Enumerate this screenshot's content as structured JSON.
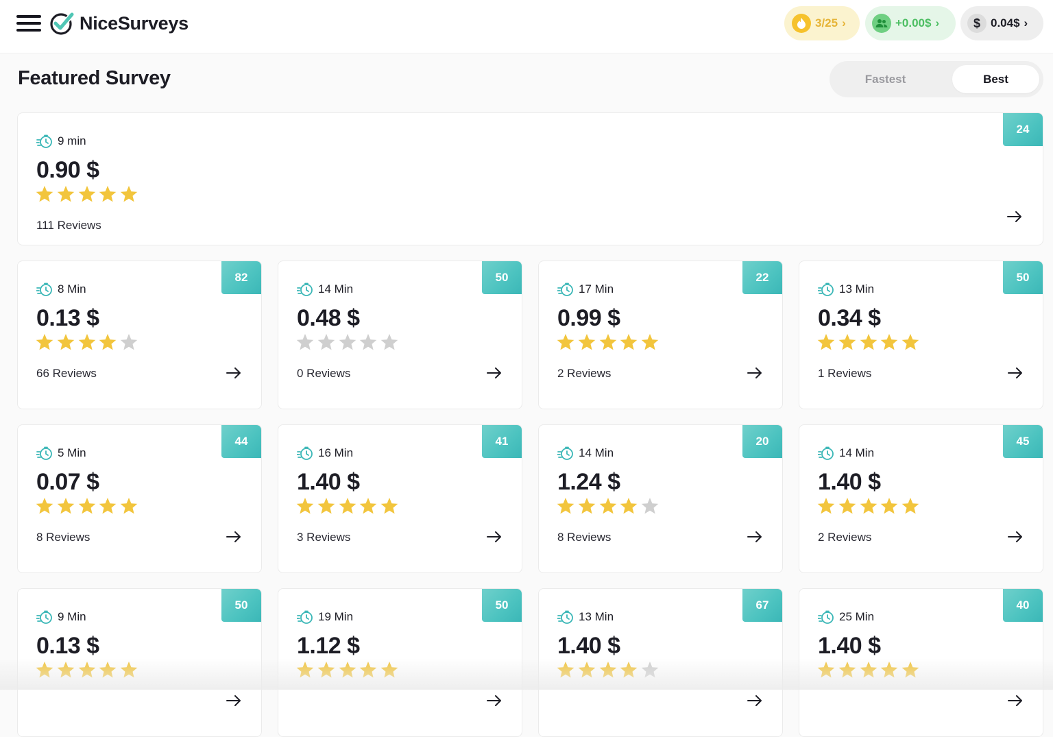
{
  "header": {
    "brand": "NiceSurveys",
    "streak": "3/25",
    "referral": "+0.00$",
    "balance": "0.04$",
    "balance_symbol": "$"
  },
  "section": {
    "title": "Featured Survey",
    "sort_options": [
      "Fastest",
      "Best"
    ],
    "sort_selected": "Best"
  },
  "colors": {
    "star_filled": "#f2c53d",
    "star_empty": "#cfcfcf",
    "badge": "#4cc3c0",
    "accent": "#3bb7b7"
  },
  "featured": {
    "badge": "24",
    "time": "9 min",
    "price": "0.90 $",
    "rating": 5,
    "reviews": "111 Reviews"
  },
  "surveys": [
    {
      "badge": "82",
      "time": "8 Min",
      "price": "0.13 $",
      "rating": 4,
      "reviews": "66 Reviews"
    },
    {
      "badge": "50",
      "time": "14 Min",
      "price": "0.48 $",
      "rating": 0,
      "reviews": "0 Reviews"
    },
    {
      "badge": "22",
      "time": "17 Min",
      "price": "0.99 $",
      "rating": 5,
      "reviews": "2 Reviews"
    },
    {
      "badge": "50",
      "time": "13 Min",
      "price": "0.34 $",
      "rating": 5,
      "reviews": "1 Reviews"
    },
    {
      "badge": "44",
      "time": "5 Min",
      "price": "0.07 $",
      "rating": 5,
      "reviews": "8 Reviews"
    },
    {
      "badge": "41",
      "time": "16 Min",
      "price": "1.40 $",
      "rating": 5,
      "reviews": "3 Reviews"
    },
    {
      "badge": "20",
      "time": "14 Min",
      "price": "1.24 $",
      "rating": 4,
      "reviews": "8 Reviews"
    },
    {
      "badge": "45",
      "time": "14 Min",
      "price": "1.40 $",
      "rating": 5,
      "reviews": "2 Reviews"
    },
    {
      "badge": "50",
      "time": "9 Min",
      "price": "0.13 $",
      "rating": 5,
      "reviews": ""
    },
    {
      "badge": "50",
      "time": "19 Min",
      "price": "1.12 $",
      "rating": 5,
      "reviews": ""
    },
    {
      "badge": "67",
      "time": "13 Min",
      "price": "1.40 $",
      "rating": 4,
      "reviews": ""
    },
    {
      "badge": "40",
      "time": "25 Min",
      "price": "1.40 $",
      "rating": 5,
      "reviews": ""
    }
  ]
}
